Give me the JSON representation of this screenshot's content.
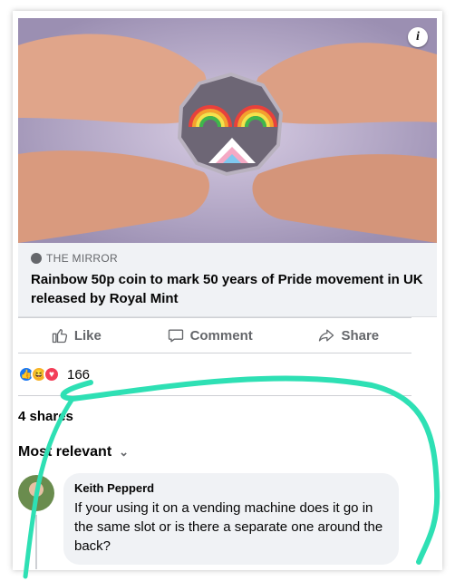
{
  "link_preview": {
    "source": "THE MIRROR",
    "headline": "Rainbow 50p coin to mark 50 years of Pride movement in UK released by Royal Mint",
    "info_icon": "i"
  },
  "actions": {
    "like": "Like",
    "comment": "Comment",
    "share": "Share"
  },
  "reactions": {
    "icons": [
      "like-icon",
      "haha-icon",
      "love-icon"
    ],
    "count": "166"
  },
  "shares": "4 shares",
  "sort": {
    "label": "Most relevant",
    "chevron": "⌄"
  },
  "comment": {
    "author": "Keith Pepperd",
    "text": "If your using it on a vending machine does it go in the same slot or is there a separate one around the back?"
  },
  "colors": {
    "scribble": "#2ee0b4",
    "accent": "#1877f2"
  }
}
